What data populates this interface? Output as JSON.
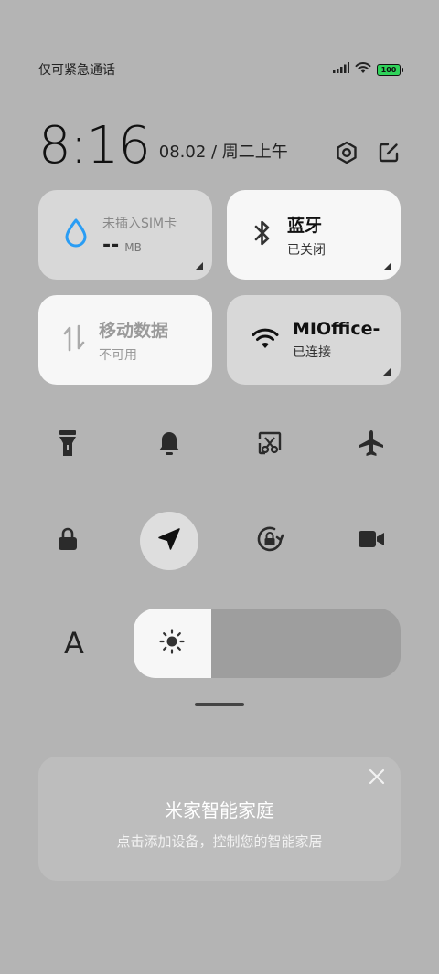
{
  "status_bar": {
    "carrier_text": "仅可紧急通话",
    "battery_level": "100",
    "icons": [
      "signal-icon",
      "wifi-icon",
      "battery-icon"
    ]
  },
  "clock": {
    "time": "8:16",
    "date": "08.02 / 周二上午"
  },
  "tiles": {
    "sim": {
      "label": "未插入SIM卡",
      "value": "--",
      "unit": "MB"
    },
    "bluetooth": {
      "title": "蓝牙",
      "status": "已关闭"
    },
    "mobile_data": {
      "title": "移动数据",
      "status": "不可用"
    },
    "wifi": {
      "title": "MIOffice-",
      "status": "已连接"
    }
  },
  "toggles_row1": [
    "flashlight-icon",
    "bell-icon",
    "screenshot-icon",
    "airplane-icon"
  ],
  "toggles_row2": [
    "lock-icon",
    "location-icon",
    "rotation-lock-icon",
    "video-icon"
  ],
  "brightness": {
    "font_label": "A",
    "level": 0.29
  },
  "smart_home_card": {
    "title": "米家智能家庭",
    "description": "点击添加设备，控制您的智能家居"
  },
  "colors": {
    "background": "#b4b4b4",
    "tile_on": "#f7f7f7",
    "tile_off": "#d8d8d8",
    "water_icon": "#2a9df4",
    "battery": "#2fd35a"
  }
}
